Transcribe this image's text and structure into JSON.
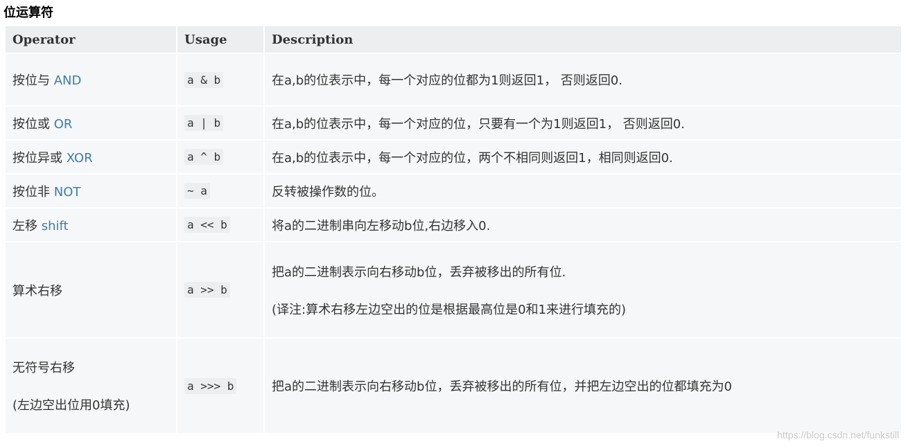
{
  "title": "位运算符",
  "table": {
    "headers": [
      "Operator",
      "Usage",
      "Description"
    ],
    "rows": [
      {
        "op_name": "按位与",
        "op_en": "AND",
        "usage": "a & b",
        "description": "在a,b的位表示中，每一个对应的位都为1则返回1， 否则返回0."
      },
      {
        "op_name": "按位或",
        "op_en": "OR",
        "usage": "a | b",
        "description": "在a,b的位表示中，每一个对应的位，只要有一个为1则返回1， 否则返回0."
      },
      {
        "op_name": "按位异或",
        "op_en": "XOR",
        "usage": "a ^ b",
        "description": "在a,b的位表示中，每一个对应的位，两个不相同则返回1，相同则返回0."
      },
      {
        "op_name": "按位非",
        "op_en": "NOT",
        "usage": "~ a",
        "description": "反转被操作数的位。"
      },
      {
        "op_name": "左移",
        "op_en": "shift",
        "usage": "a << b",
        "description": "将a的二进制串向左移动b位,右边移入0."
      },
      {
        "op_name": "算术右移",
        "op_en": "",
        "usage": "a >> b",
        "description": "把a的二进制表示向右移动b位，丢弃被移出的所有位.",
        "description_note": "(译注:算术右移左边空出的位是根据最高位是0和1来进行填充的)"
      },
      {
        "op_name": "无符号右移",
        "op_note": "(左边空出位用0填充)",
        "usage": "a >>> b",
        "description": "把a的二进制表示向右移动b位，丢弃被移出的所有位，并把左边空出的位都填充为0"
      }
    ]
  },
  "watermark": "https://blog.csdn.net/funkstill"
}
